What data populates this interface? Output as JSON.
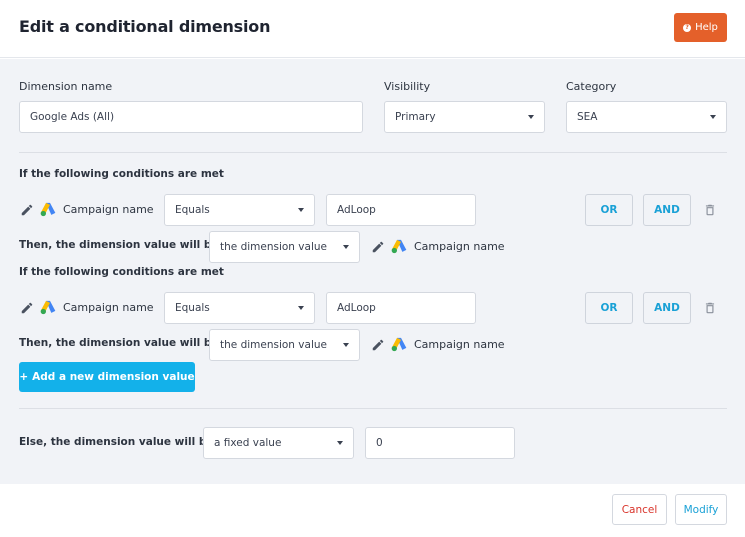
{
  "header": {
    "title": "Edit a conditional dimension",
    "help_label": "Help"
  },
  "fields": {
    "dimension_name_label": "Dimension name",
    "dimension_name_value": "Google Ads (All)",
    "visibility_label": "Visibility",
    "visibility_value": "Primary",
    "category_label": "Category",
    "category_value": "SEA"
  },
  "conditions": [
    {
      "heading": "If the following conditions are met",
      "source_label": "Campaign name",
      "operator": "Equals",
      "value": "AdLoop",
      "or_label": "OR",
      "and_label": "AND",
      "then_label": "Then, the dimension value will be:",
      "then_value": "the dimension value",
      "then_source_label": "Campaign name"
    },
    {
      "heading": "If the following conditions are met",
      "source_label": "Campaign name",
      "operator": "Equals",
      "value": "AdLoop",
      "or_label": "OR",
      "and_label": "AND",
      "then_label": "Then, the dimension value will be:",
      "then_value": "the dimension value",
      "then_source_label": "Campaign name"
    }
  ],
  "add_dimension_label": "Add a new dimension value",
  "else": {
    "label": "Else, the dimension value will be:",
    "mode": "a fixed value",
    "value": "0"
  },
  "footer": {
    "cancel_label": "Cancel",
    "modify_label": "Modify"
  },
  "colors": {
    "accent": "#13b1ea",
    "help": "#e4602a",
    "cancel": "#d9342b",
    "google_blue": "#4285f4",
    "google_yellow": "#fbbc04",
    "google_green": "#34a853"
  }
}
